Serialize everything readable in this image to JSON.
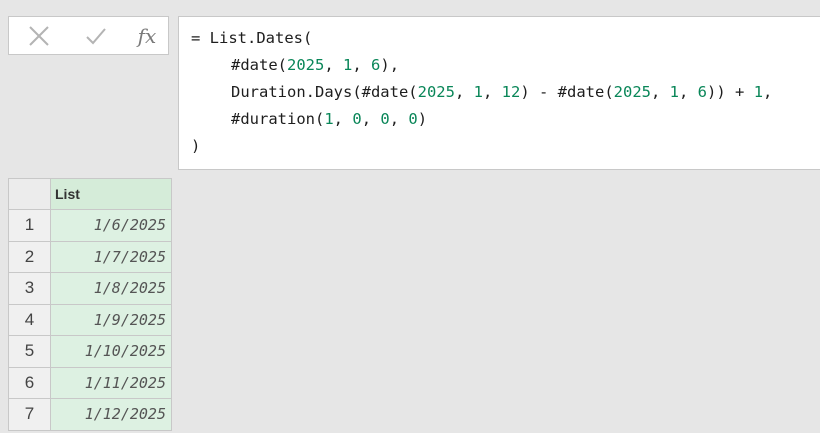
{
  "formula_bar": {
    "cancel_icon": "close-icon",
    "enter_icon": "checkmark-icon",
    "fx_label": "fx",
    "lines": [
      {
        "indent": false,
        "tokens": [
          {
            "t": "= List.Dates(",
            "c": "code"
          }
        ]
      },
      {
        "indent": true,
        "tokens": [
          {
            "t": "#date(",
            "c": "code"
          },
          {
            "t": "2025",
            "c": "num"
          },
          {
            "t": ", ",
            "c": "code"
          },
          {
            "t": "1",
            "c": "num"
          },
          {
            "t": ", ",
            "c": "code"
          },
          {
            "t": "6",
            "c": "num"
          },
          {
            "t": "),",
            "c": "code"
          }
        ]
      },
      {
        "indent": true,
        "tokens": [
          {
            "t": "Duration.Days(#date(",
            "c": "code"
          },
          {
            "t": "2025",
            "c": "num"
          },
          {
            "t": ", ",
            "c": "code"
          },
          {
            "t": "1",
            "c": "num"
          },
          {
            "t": ", ",
            "c": "code"
          },
          {
            "t": "12",
            "c": "num"
          },
          {
            "t": ") - #date(",
            "c": "code"
          },
          {
            "t": "2025",
            "c": "num"
          },
          {
            "t": ", ",
            "c": "code"
          },
          {
            "t": "1",
            "c": "num"
          },
          {
            "t": ", ",
            "c": "code"
          },
          {
            "t": "6",
            "c": "num"
          },
          {
            "t": ")) + ",
            "c": "code"
          },
          {
            "t": "1",
            "c": "num"
          },
          {
            "t": ",",
            "c": "code"
          }
        ]
      },
      {
        "indent": true,
        "tokens": [
          {
            "t": "#duration(",
            "c": "code"
          },
          {
            "t": "1",
            "c": "num"
          },
          {
            "t": ", ",
            "c": "code"
          },
          {
            "t": "0",
            "c": "num"
          },
          {
            "t": ", ",
            "c": "code"
          },
          {
            "t": "0",
            "c": "num"
          },
          {
            "t": ", ",
            "c": "code"
          },
          {
            "t": "0",
            "c": "num"
          },
          {
            "t": ")",
            "c": "code"
          }
        ]
      },
      {
        "indent": false,
        "tokens": [
          {
            "t": ")",
            "c": "code"
          }
        ]
      }
    ]
  },
  "grid": {
    "column_header": "List",
    "rows": [
      {
        "num": "1",
        "value": "1/6/2025"
      },
      {
        "num": "2",
        "value": "1/7/2025"
      },
      {
        "num": "3",
        "value": "1/8/2025"
      },
      {
        "num": "4",
        "value": "1/9/2025"
      },
      {
        "num": "5",
        "value": "1/10/2025"
      },
      {
        "num": "6",
        "value": "1/11/2025"
      },
      {
        "num": "7",
        "value": "1/12/2025"
      }
    ]
  },
  "colors": {
    "number_literal": "#098658",
    "header_bg": "#d5ecd9",
    "cell_bg": "#ddf1e2"
  }
}
